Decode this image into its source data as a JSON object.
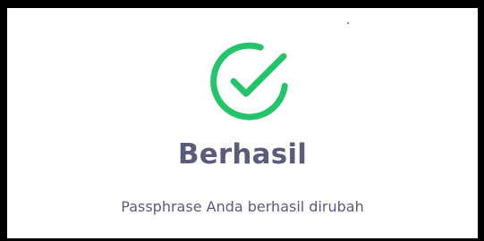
{
  "dialog": {
    "icon": "check-circle-icon",
    "icon_color": "#27c26c",
    "title": "Berhasil",
    "message": "Passphrase Anda berhasil dirubah",
    "text_color": "#5a5c79"
  }
}
